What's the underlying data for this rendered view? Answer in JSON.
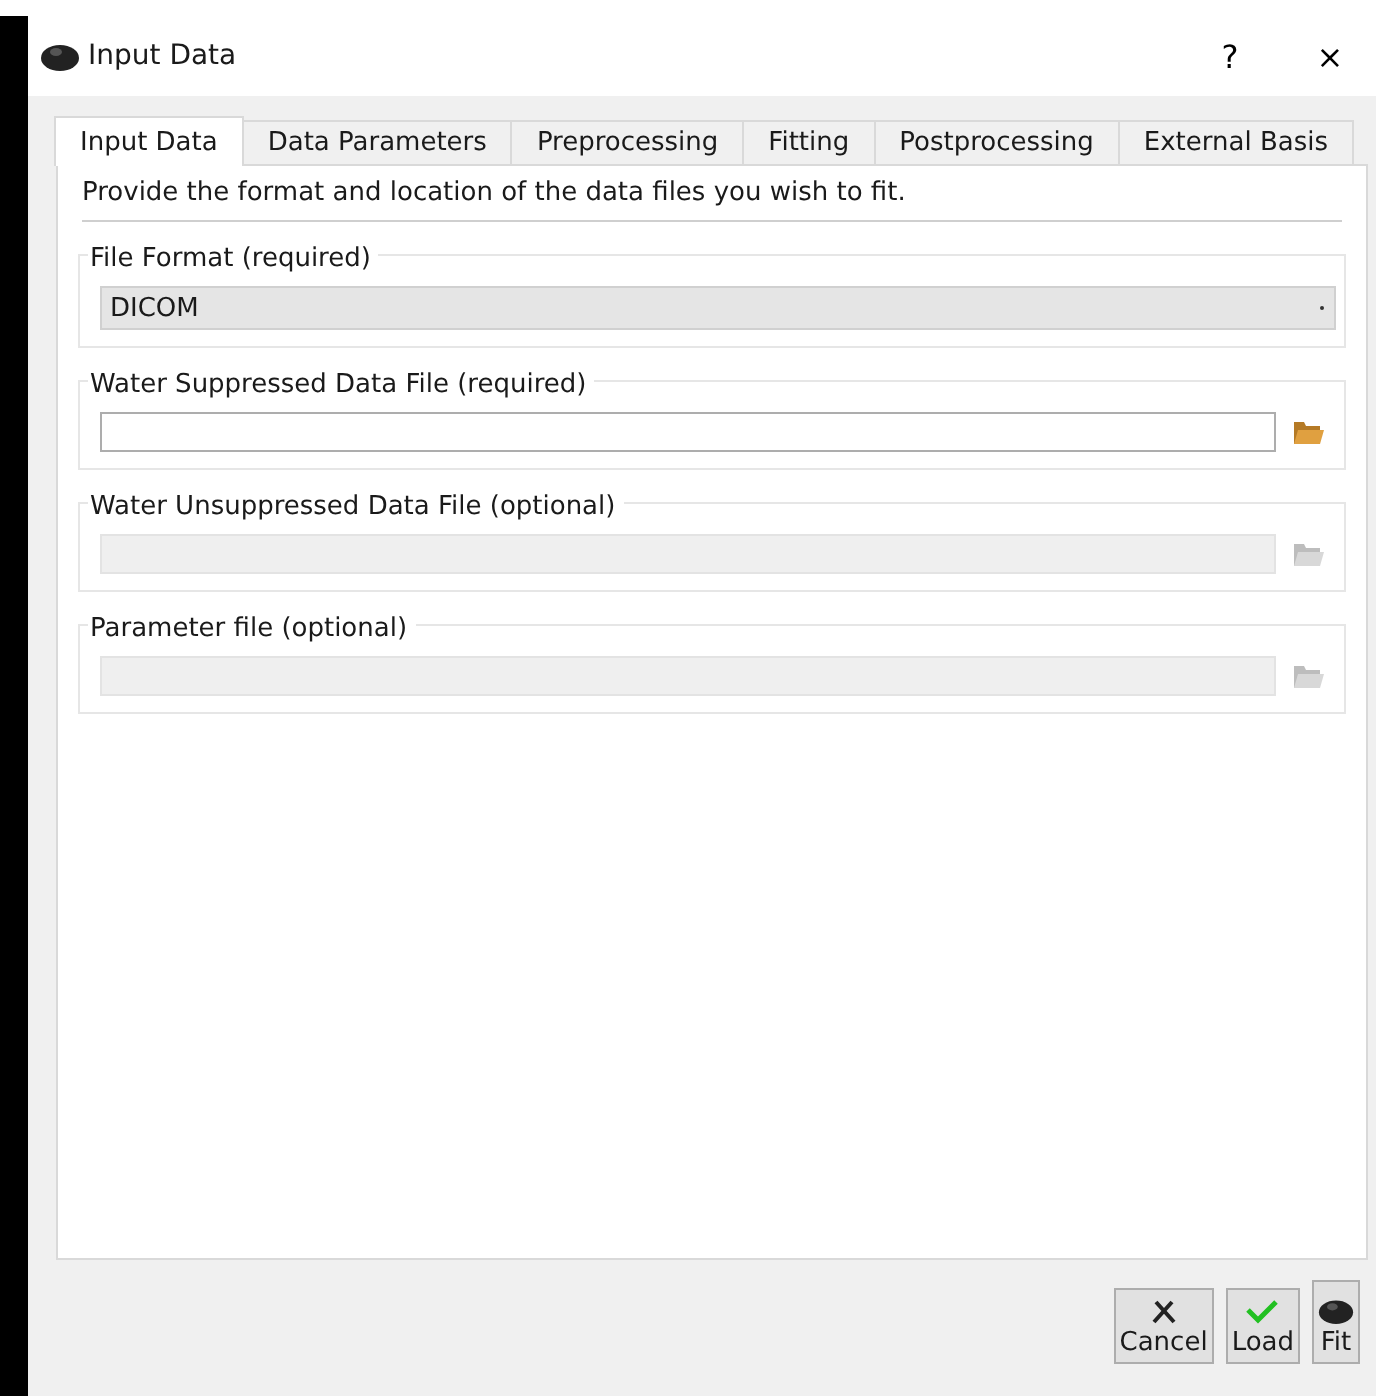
{
  "window": {
    "title": "Input Data",
    "help": "?",
    "close": "×"
  },
  "tabs": [
    {
      "label": "Input Data",
      "selected": true
    },
    {
      "label": "Data Parameters",
      "selected": false
    },
    {
      "label": "Preprocessing",
      "selected": false
    },
    {
      "label": "Fitting",
      "selected": false
    },
    {
      "label": "Postprocessing",
      "selected": false
    },
    {
      "label": "External Basis",
      "selected": false
    }
  ],
  "description": "Provide the format and location of the data files you wish to fit.",
  "groups": [
    {
      "kind": "combo",
      "title": "File Format (required)",
      "value": "DICOM"
    },
    {
      "kind": "file",
      "title": "Water Suppressed Data File (required)",
      "disabled": false
    },
    {
      "kind": "file",
      "title": "Water Unsuppressed Data File (optional)",
      "disabled": true
    },
    {
      "kind": "file",
      "title": "Parameter file (optional)",
      "disabled": true
    }
  ],
  "buttons": [
    {
      "kind": "cancel",
      "label": "Cancel"
    },
    {
      "kind": "load",
      "label": "Load"
    },
    {
      "kind": "fit",
      "label": "Fit"
    }
  ]
}
